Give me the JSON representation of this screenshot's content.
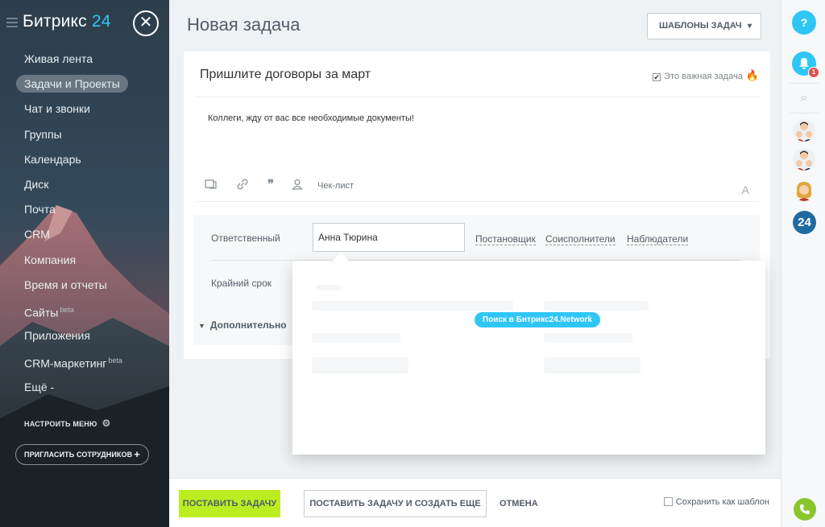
{
  "sidebar": {
    "logo_text": "Битрикс",
    "logo_num": "24",
    "items": [
      {
        "label": "Живая лента"
      },
      {
        "label": "Задачи и Проекты",
        "active": true
      },
      {
        "label": "Чат и звонки"
      },
      {
        "label": "Группы"
      },
      {
        "label": "Календарь"
      },
      {
        "label": "Диск"
      },
      {
        "label": "Почта"
      },
      {
        "label": "CRM"
      },
      {
        "label": "Компания"
      },
      {
        "label": "Время и отчеты"
      },
      {
        "label": "Сайты",
        "badge": "beta"
      },
      {
        "label": "Приложения"
      },
      {
        "label": "CRM-маркетинг",
        "badge": "beta"
      },
      {
        "label": "Ещё -"
      }
    ],
    "configure_label": "НАСТРОИТЬ МЕНЮ",
    "invite_label": "ПРИГЛАСИТЬ СОТРУДНИКОВ"
  },
  "header": {
    "title": "Новая задача",
    "templates_label": "ШАБЛОНЫ ЗАДАЧ"
  },
  "task": {
    "title": "Пришлите договоры за март",
    "important_label": "Это важная задача",
    "important_checked": true,
    "description": "Коллеги, жду от вас все необходимые документы!",
    "checklist_label": "Чек-лист",
    "font_label": "A"
  },
  "fields": {
    "responsible_label": "Ответственный",
    "responsible_value": "Анна Тюрина",
    "roles": [
      "Постановщик",
      "Соисполнители",
      "Наблюдатели"
    ],
    "deadline_label": "Крайний срок",
    "more_label": "Дополнительно"
  },
  "popup": {
    "network_search_label": "Поиск в Битрикс24.Network"
  },
  "footer": {
    "submit_label": "ПОСТАВИТЬ ЗАДАЧУ",
    "submit_and_create_label": "ПОСТАВИТЬ ЗАДАЧУ И СОЗДАТЬ ЕЩЕ",
    "cancel_label": "ОТМЕНА",
    "save_template_label": "Сохранить как шаблон"
  },
  "rail": {
    "help_label": "?",
    "notifications_count": "1",
    "b24_label": "24"
  },
  "colors": {
    "accent": "#2fc6f6",
    "primary_button": "#bbed21",
    "badge": "#e64f4f",
    "fire": "#f27e23"
  }
}
